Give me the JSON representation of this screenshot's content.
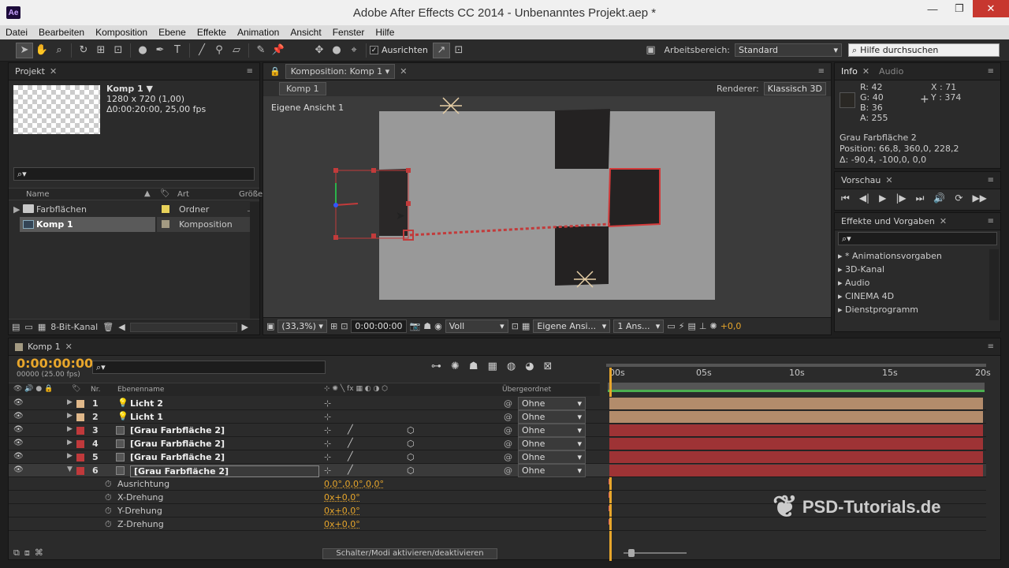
{
  "window": {
    "title": "Adobe After Effects CC 2014 - Unbenanntes Projekt.aep *",
    "app_badge": "Ae"
  },
  "menu": [
    "Datei",
    "Bearbeiten",
    "Komposition",
    "Ebene",
    "Effekte",
    "Animation",
    "Ansicht",
    "Fenster",
    "Hilfe"
  ],
  "toolbar": {
    "align_label": "Ausrichten",
    "workspace_label": "Arbeitsbereich:",
    "workspace_value": "Standard",
    "help_placeholder": "Hilfe durchsuchen"
  },
  "project": {
    "tab": "Projekt",
    "comp_name": "Komp 1 ▼",
    "comp_size": "1280 x 720 (1,00)",
    "comp_duration": "Δ0:00:20:00, 25,00 fps",
    "search_placeholder": "⌕▾",
    "headers": {
      "name": "Name",
      "type": "Art",
      "size": "Größe"
    },
    "items": [
      {
        "name": "Farbflächen",
        "type": "Ordner",
        "color": "#e8d25a",
        "icon": "folder-icon"
      },
      {
        "name": "Komp 1",
        "type": "Komposition",
        "color": "#a39a82",
        "icon": "composition-icon"
      }
    ],
    "bitdepth": "8-Bit-Kanal"
  },
  "composition": {
    "tab": "Komposition: Komp 1",
    "subtab": "Komp 1",
    "renderer_label": "Renderer:",
    "renderer_value": "Klassisch 3D",
    "view_label": "Eigene Ansicht 1",
    "zoom": "(33,3%)",
    "timecode": "0:00:00:00",
    "resolution": "Voll",
    "view_select": "Eigene Ansi...",
    "views_count": "1 Ans...",
    "exposure": "+0,0"
  },
  "info": {
    "tab": "Info",
    "tab2": "Audio",
    "r": "R:  42",
    "g": "G:  40",
    "b": "B:  36",
    "a": "A:  255",
    "x": "X : 71",
    "y": "Y : 374",
    "layer": "Grau Farbfläche 2",
    "position": "Position: 66,8, 360,0, 228,2",
    "delta": "Δ: -90,4, -100,0, 0,0"
  },
  "preview": {
    "tab": "Vorschau"
  },
  "effects": {
    "tab": "Effekte und Vorgaben",
    "search_placeholder": "⌕▾",
    "items": [
      "* Animationsvorgaben",
      "3D-Kanal",
      "Audio",
      "CINEMA 4D",
      "Dienstprogramm"
    ]
  },
  "timeline": {
    "tab": "Komp 1",
    "timecode": "0:00:00:00",
    "fps": "00000 (25.00 fps)",
    "headers": {
      "nr": "Nr.",
      "name": "Ebenenname",
      "parent": "Übergeordnet"
    },
    "layers": [
      {
        "nr": "1",
        "name": "Licht 2",
        "color": "#e0b88a",
        "parent": "Ohne",
        "kind": "light"
      },
      {
        "nr": "2",
        "name": "Licht 1",
        "color": "#e0b88a",
        "parent": "Ohne",
        "kind": "light"
      },
      {
        "nr": "3",
        "name": "[Grau Farbfläche 2]",
        "color": "#c0393b",
        "parent": "Ohne",
        "kind": "solid"
      },
      {
        "nr": "4",
        "name": "[Grau Farbfläche 2]",
        "color": "#c0393b",
        "parent": "Ohne",
        "kind": "solid"
      },
      {
        "nr": "5",
        "name": "[Grau Farbfläche 2]",
        "color": "#c0393b",
        "parent": "Ohne",
        "kind": "solid"
      },
      {
        "nr": "6",
        "name": "[Grau Farbfläche 2]",
        "color": "#c0393b",
        "parent": "Ohne",
        "kind": "solid"
      }
    ],
    "properties": [
      {
        "name": "Ausrichtung",
        "value": "0,0°,0,0°,0,0°"
      },
      {
        "name": "X-Drehung",
        "value": "0x+0,0°"
      },
      {
        "name": "Y-Drehung",
        "value": "0x+0,0°"
      },
      {
        "name": "Z-Drehung",
        "value": "0x+0,0°"
      }
    ],
    "ruler": [
      "00s",
      "05s",
      "10s",
      "15s",
      "20s"
    ],
    "switch_button": "Schalter/Modi aktivieren/deaktivieren"
  },
  "watermark": "PSD-Tutorials.de"
}
